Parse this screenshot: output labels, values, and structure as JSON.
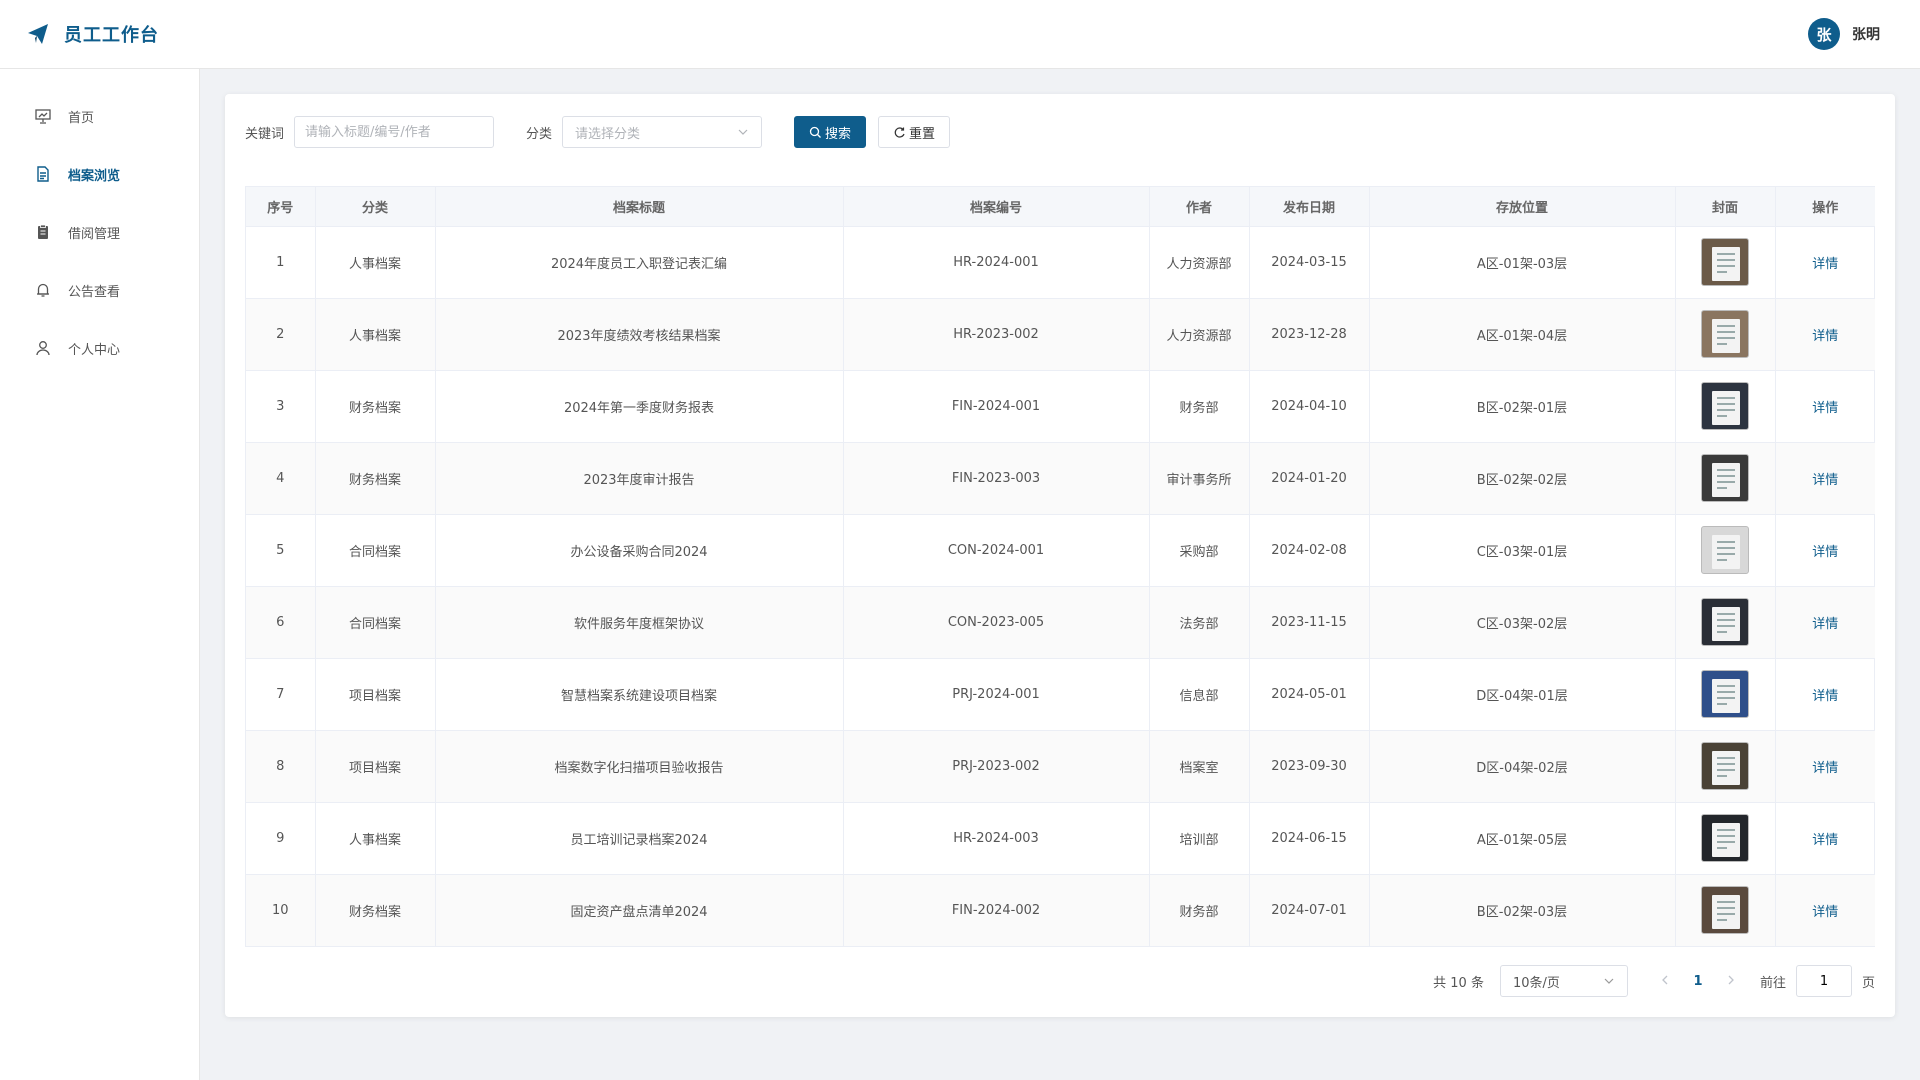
{
  "header": {
    "title": "员工工作台",
    "user": {
      "avatar_text": "张",
      "name": "张明"
    }
  },
  "sidebar": {
    "items": [
      {
        "label": "首页",
        "icon": "presentation-icon",
        "active": false
      },
      {
        "label": "档案浏览",
        "icon": "document-icon",
        "active": true
      },
      {
        "label": "借阅管理",
        "icon": "clipboard-icon",
        "active": false
      },
      {
        "label": "公告查看",
        "icon": "bell-icon",
        "active": false
      },
      {
        "label": "个人中心",
        "icon": "user-icon",
        "active": false
      }
    ]
  },
  "search": {
    "keyword_label": "关键词",
    "keyword_placeholder": "请输入标题/编号/作者",
    "category_label": "分类",
    "category_placeholder": "请选择分类",
    "search_button": "搜索",
    "reset_button": "重置"
  },
  "table": {
    "columns": [
      "序号",
      "分类",
      "档案标题",
      "档案编号",
      "作者",
      "发布日期",
      "存放位置",
      "封面",
      "操作"
    ],
    "detail_label": "详情",
    "rows": [
      {
        "no": "1",
        "category": "人事档案",
        "title": "2024年度员工入职登记表汇编",
        "code": "HR-2024-001",
        "author": "人力资源部",
        "date": "2024-03-15",
        "location": "A区-01架-03层",
        "cover_color": "#6b5a48"
      },
      {
        "no": "2",
        "category": "人事档案",
        "title": "2023年度绩效考核结果档案",
        "code": "HR-2023-002",
        "author": "人力资源部",
        "date": "2023-12-28",
        "location": "A区-01架-04层",
        "cover_color": "#8a7560"
      },
      {
        "no": "3",
        "category": "财务档案",
        "title": "2024年第一季度财务报表",
        "code": "FIN-2024-001",
        "author": "财务部",
        "date": "2024-04-10",
        "location": "B区-02架-01层",
        "cover_color": "#2d3440"
      },
      {
        "no": "4",
        "category": "财务档案",
        "title": "2023年度审计报告",
        "code": "FIN-2023-003",
        "author": "审计事务所",
        "date": "2024-01-20",
        "location": "B区-02架-02层",
        "cover_color": "#3a3a3a"
      },
      {
        "no": "5",
        "category": "合同档案",
        "title": "办公设备采购合同2024",
        "code": "CON-2024-001",
        "author": "采购部",
        "date": "2024-02-08",
        "location": "C区-03架-01层",
        "cover_color": "#d8d8d8"
      },
      {
        "no": "6",
        "category": "合同档案",
        "title": "软件服务年度框架协议",
        "code": "CON-2023-005",
        "author": "法务部",
        "date": "2023-11-15",
        "location": "C区-03架-02层",
        "cover_color": "#2a2e36"
      },
      {
        "no": "7",
        "category": "项目档案",
        "title": "智慧档案系统建设项目档案",
        "code": "PRJ-2024-001",
        "author": "信息部",
        "date": "2024-05-01",
        "location": "D区-04架-01层",
        "cover_color": "#2f4f8a"
      },
      {
        "no": "8",
        "category": "项目档案",
        "title": "档案数字化扫描项目验收报告",
        "code": "PRJ-2023-002",
        "author": "档案室",
        "date": "2023-09-30",
        "location": "D区-04架-02层",
        "cover_color": "#4a4236"
      },
      {
        "no": "9",
        "category": "人事档案",
        "title": "员工培训记录档案2024",
        "code": "HR-2024-003",
        "author": "培训部",
        "date": "2024-06-15",
        "location": "A区-01架-05层",
        "cover_color": "#23262b"
      },
      {
        "no": "10",
        "category": "财务档案",
        "title": "固定资产盘点清单2024",
        "code": "FIN-2024-002",
        "author": "财务部",
        "date": "2024-07-01",
        "location": "B区-02架-03层",
        "cover_color": "#5a4a3e"
      }
    ]
  },
  "pagination": {
    "total_text": "共 10 条",
    "page_size": "10条/页",
    "current_page": "1",
    "goto_label": "前往",
    "goto_value": "1",
    "page_unit": "页"
  }
}
